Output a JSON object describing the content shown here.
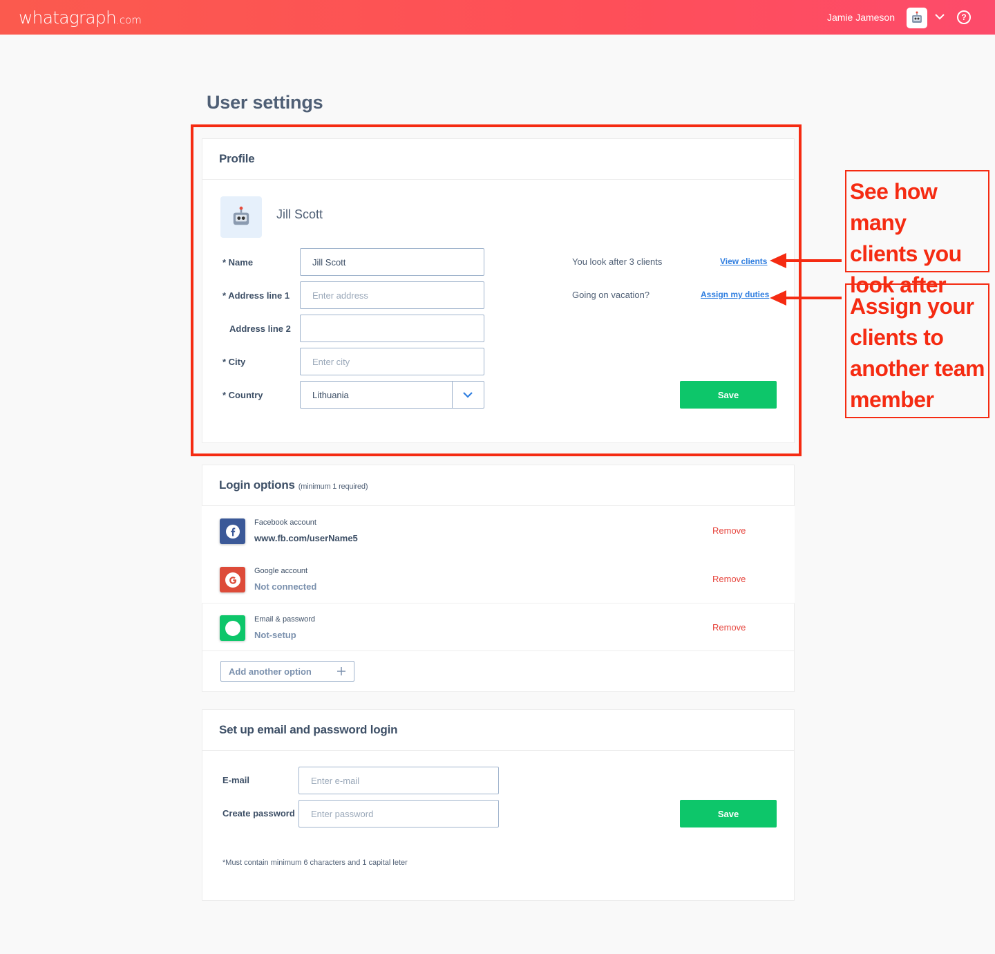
{
  "topbar": {
    "logo_main": "whatagraph",
    "logo_suffix": ".com",
    "user_name": "Jamie Jameson",
    "help_label": "?"
  },
  "page_title": "User settings",
  "profile": {
    "header": "Profile",
    "display_name": "Jill Scott",
    "fields": {
      "name": {
        "label": "* Name",
        "value": "Jill Scott"
      },
      "address1": {
        "label": "* Address line 1",
        "placeholder": "Enter address"
      },
      "address2": {
        "label": "Address line 2",
        "value": ""
      },
      "city": {
        "label": "* City",
        "placeholder": "Enter city"
      },
      "country": {
        "label": "* Country",
        "value": "Lithuania"
      }
    },
    "clients_text": "You look after 3 clients",
    "view_clients_link": "View clients",
    "vacation_text": "Going on vacation?",
    "assign_duties_link": "Assign my duties",
    "save_label": "Save"
  },
  "annotations": {
    "clients_note": [
      "See how many",
      "clients you",
      "look after"
    ],
    "assign_note": [
      "Assign your",
      "clients to",
      "another team",
      "member"
    ],
    "color": "#f52b12"
  },
  "login_options": {
    "header": "Login options",
    "header_sub": "(minimum 1 required)",
    "rows": [
      {
        "title": "Facebook account",
        "value": "www.fb.com/userName5",
        "remove": "Remove",
        "icon": "facebook-icon"
      },
      {
        "title": "Google account",
        "value": "Not connected",
        "remove": "Remove",
        "icon": "google-icon"
      },
      {
        "title": "Email & password",
        "value": "Not-setup",
        "remove": "Remove",
        "icon": "email-icon"
      }
    ],
    "add_label": "Add another option"
  },
  "email_login": {
    "header": "Set up email and password login",
    "email_label": "E-mail",
    "email_placeholder": "Enter e-mail",
    "password_label": "Create password",
    "password_placeholder": "Enter password",
    "save_label": "Save",
    "footnote": "*Must contain minimum 6 characters and 1 capital leter"
  },
  "colors": {
    "accent_green": "#0dc66a",
    "link_blue": "#2f7ee0",
    "remove_red": "#e6443c",
    "facebook_blue": "#3b5998",
    "google_red": "#dd4b39"
  }
}
